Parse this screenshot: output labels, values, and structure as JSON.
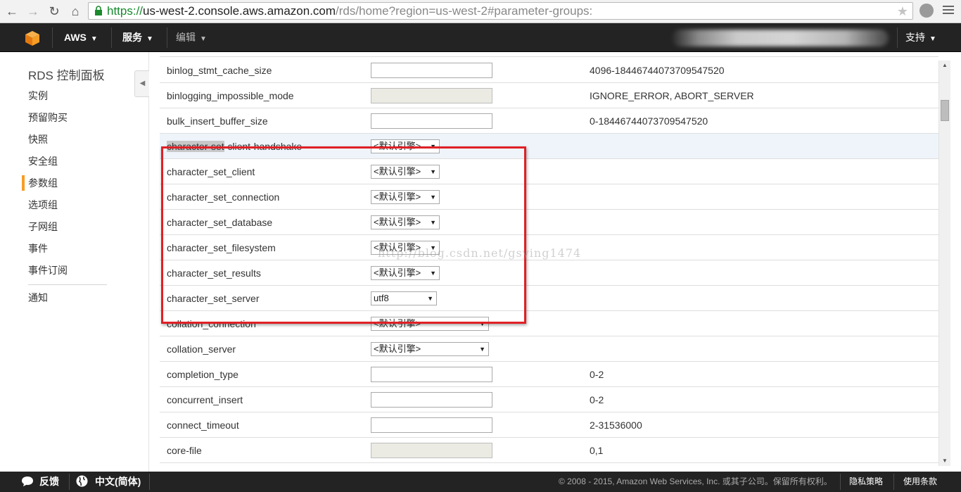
{
  "browser": {
    "url_https": "https://",
    "url_host": "us-west-2.console.aws.amazon.com",
    "url_path": "/rds/home?region=us-west-2#parameter-groups:"
  },
  "topnav": {
    "brand": "AWS",
    "services": "服务",
    "edit": "编辑",
    "support": "支持"
  },
  "sidebar": {
    "title": "RDS 控制面板",
    "items": [
      "实例",
      "预留购买",
      "快照",
      "安全组",
      "参数组",
      "选项组",
      "子网组",
      "事件",
      "事件订阅"
    ],
    "active_item": "参数组",
    "extra_item": "通知"
  },
  "parameters": [
    {
      "name": "binlog_stmt_cache_size",
      "control": "text",
      "allowed": "4096-18446744073709547520"
    },
    {
      "name": "binlogging_impossible_mode",
      "control": "text-disabled",
      "allowed": "IGNORE_ERROR, ABORT_SERVER"
    },
    {
      "name": "bulk_insert_buffer_size",
      "control": "text",
      "allowed": "0-18446744073709547520"
    },
    {
      "name_sel": "character-set",
      "name_rest": "-client-handshake",
      "control": "select",
      "value": "<默认引擎>",
      "allowed": ""
    },
    {
      "name": "character_set_client",
      "control": "select",
      "value": "<默认引擎>",
      "allowed": ""
    },
    {
      "name": "character_set_connection",
      "control": "select",
      "value": "<默认引擎>",
      "allowed": ""
    },
    {
      "name": "character_set_database",
      "control": "select",
      "value": "<默认引擎>",
      "allowed": ""
    },
    {
      "name": "character_set_filesystem",
      "control": "select",
      "value": "<默认引擎>",
      "allowed": ""
    },
    {
      "name": "character_set_results",
      "control": "select",
      "value": "<默认引擎>",
      "allowed": ""
    },
    {
      "name": "character_set_server",
      "control": "select",
      "value": "utf8",
      "allowed": ""
    },
    {
      "name": "collation_connection",
      "control": "select-wide",
      "value": "<默认引擎>",
      "allowed": ""
    },
    {
      "name": "collation_server",
      "control": "select-wide",
      "value": "<默认引擎>",
      "allowed": ""
    },
    {
      "name": "completion_type",
      "control": "text",
      "allowed": "0-2"
    },
    {
      "name": "concurrent_insert",
      "control": "text",
      "allowed": "0-2"
    },
    {
      "name": "connect_timeout",
      "control": "text",
      "allowed": "2-31536000"
    },
    {
      "name": "core-file",
      "control": "text-disabled",
      "allowed": "0,1"
    }
  ],
  "watermark": "http://blog.csdn.net/gsying1474",
  "footer": {
    "feedback": "反馈",
    "language": "中文(简体)",
    "copyright": "© 2008 - 2015, Amazon Web Services, Inc. 或其子公司。保留所有权利。",
    "privacy": "隐私策略",
    "terms": "使用条款"
  },
  "colors": {
    "aws_orange": "#f79d25",
    "highlight_box": "#e02026",
    "nav_bg": "#232323"
  }
}
